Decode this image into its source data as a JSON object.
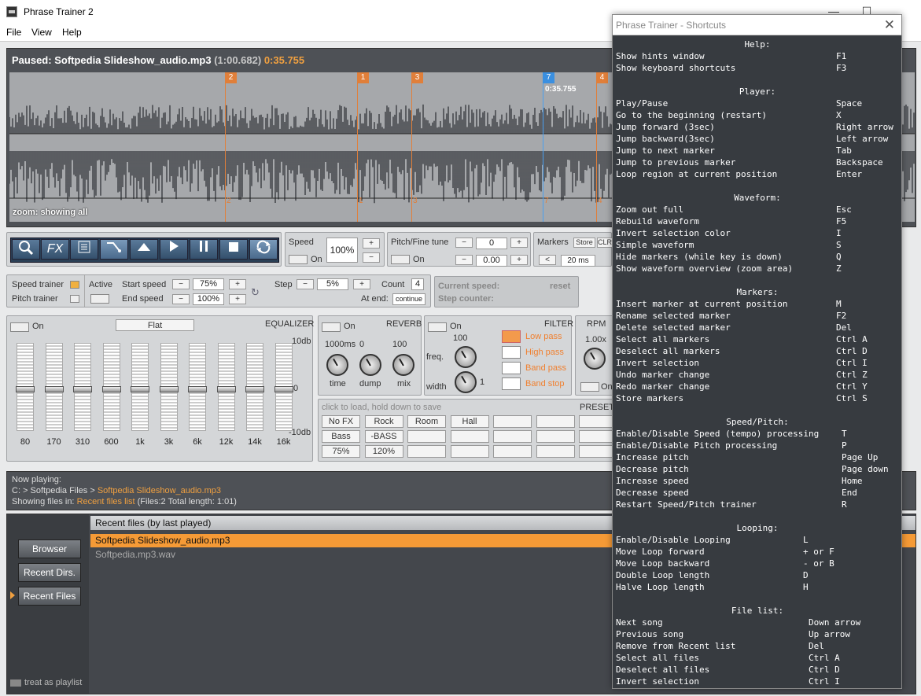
{
  "window": {
    "title": "Phrase Trainer 2"
  },
  "menu": [
    "File",
    "View",
    "Help"
  ],
  "waveform": {
    "state": "Paused:",
    "filename": "Softpedia Slideshow_audio.mp3",
    "length": "(1:00.682)",
    "position": "0:35.755",
    "zoom_label": "zoom: showing all",
    "cursor_time": "0:35.755",
    "markers": [
      {
        "label": "2",
        "pos": 0.238,
        "color": "orange"
      },
      {
        "label": "1",
        "pos": 0.384,
        "color": "orange"
      },
      {
        "label": "3",
        "pos": 0.444,
        "color": "orange"
      },
      {
        "label": "7",
        "pos": 0.589,
        "color": "blue"
      },
      {
        "label": "4",
        "pos": 0.648,
        "color": "orange"
      }
    ]
  },
  "toolbar": {
    "fx_label": "FX",
    "speed_label": "Speed",
    "speed_value": "100%",
    "speed_on": "On",
    "pitch_label": "Pitch/Fine tune",
    "pitch_value": "0",
    "fine_value": "0.00",
    "pitch_on": "On",
    "markers_label": "Markers",
    "markers_store": "Store",
    "markers_clr": "CLR",
    "markers_ms": "20 ms"
  },
  "trainer": {
    "speed_trainer": "Speed trainer",
    "pitch_trainer": "Pitch   trainer",
    "active": "Active",
    "start_speed_label": "Start speed",
    "start_speed": "75%",
    "end_speed_label": "End  speed",
    "end_speed": "100%",
    "step_label": "Step",
    "step_value": "5%",
    "count_label": "Count",
    "count_value": "4",
    "at_end_label": "At end:",
    "at_end_value": "continue",
    "current_speed": "Current speed:",
    "reset": "reset",
    "step_counter": "Step counter:"
  },
  "eq": {
    "on": "On",
    "preset": "Flat",
    "title": "EQUALIZER",
    "db_top": "10db",
    "db_mid": "0",
    "db_bot": "-10db",
    "bands": [
      "80",
      "170",
      "310",
      "600",
      "1k",
      "3k",
      "6k",
      "12k",
      "14k",
      "16k"
    ]
  },
  "reverb": {
    "on": "On",
    "title": "REVERB",
    "time_val": "1000ms",
    "dump_val": "0",
    "mix_val": "100",
    "time": "time",
    "dump": "dump",
    "mix": "mix"
  },
  "filter": {
    "on": "On",
    "title": "FILTER",
    "freq_val": "100",
    "freq": "freq.",
    "width": "width",
    "width_val": "1",
    "types": [
      "Low pass",
      "High pass",
      "Band pass",
      "Band stop"
    ]
  },
  "rpm": {
    "title": "RPM",
    "value": "1.00x",
    "on": "On"
  },
  "presets": {
    "hint": "click to load, hold down to save",
    "title": "PRESETS",
    "row1": [
      "No FX",
      "Rock",
      "Room",
      "Hall",
      "",
      "",
      ""
    ],
    "row2": [
      "Bass",
      "-BASS",
      "",
      "",
      "",
      "",
      ""
    ],
    "row3": [
      "75%",
      "120%",
      "",
      "",
      "",
      "",
      ""
    ]
  },
  "file_info": {
    "now_playing": "Now playing:",
    "path_prefix": "C: > Softpedia Files >",
    "path_file": "Softpedia Slideshow_audio.mp3",
    "showing": "Showing files in:",
    "list_name": "Recent files list",
    "stats": "(Files:2  Total length: 1:01)"
  },
  "nav": {
    "browser": "Browser",
    "recent_dirs": "Recent Dirs.",
    "recent_files": "Recent Files",
    "playlist": "treat as playlist"
  },
  "file_list": {
    "header": "Recent files (by last played)",
    "files": [
      "Softpedia Slideshow_audio.mp3",
      "Softpedia.mp3.wav"
    ]
  },
  "shortcuts": {
    "title": "Phrase Trainer - Shortcuts",
    "sections": [
      {
        "head": "Help:",
        "keycol": 280,
        "rows": [
          [
            "Show hints window",
            "F1"
          ],
          [
            "Show keyboard shortcuts",
            "F3"
          ]
        ]
      },
      {
        "head": "Player:",
        "keycol": 280,
        "rows": [
          [
            "Play/Pause",
            "Space"
          ],
          [
            "Go to the beginning (restart)",
            "X"
          ],
          [
            "Jump forward (3sec)",
            "Right arrow"
          ],
          [
            "Jump backward(3sec)",
            "Left arrow"
          ],
          [
            "Jump to next marker",
            "Tab"
          ],
          [
            "Jump to previous marker",
            "Backspace"
          ],
          [
            "Loop region at current position",
            "Enter"
          ]
        ]
      },
      {
        "head": "Waveform:",
        "keycol": 280,
        "rows": [
          [
            "Zoom out full",
            "Esc"
          ],
          [
            "Rebuild waveform",
            "F5"
          ],
          [
            "Invert selection color",
            "I"
          ],
          [
            "Simple waveform",
            "S"
          ],
          [
            "Hide markers (while key is down)",
            "Q"
          ],
          [
            "Show waveform overview (zoom area)",
            "Z"
          ]
        ]
      },
      {
        "head": "Markers:",
        "keycol": 280,
        "rows": [
          [
            "Insert marker at current position",
            "M"
          ],
          [
            "Rename selected marker",
            "F2"
          ],
          [
            "Delete selected marker",
            "Del"
          ],
          [
            "Select all markers",
            "Ctrl A"
          ],
          [
            "Deselect all markers",
            "Ctrl D"
          ],
          [
            "Invert selection",
            "Ctrl I"
          ],
          [
            "Undo marker change",
            "Ctrl Z"
          ],
          [
            "Redo marker change",
            "Ctrl Y"
          ],
          [
            "Store markers",
            "Ctrl S"
          ]
        ]
      },
      {
        "head": "Speed/Pitch:",
        "keycol": 287,
        "rows": [
          [
            "Enable/Disable Speed (tempo) processing",
            "T"
          ],
          [
            "Enable/Disable Pitch processing",
            "P"
          ],
          [
            "Increase pitch",
            "Page Up"
          ],
          [
            "Decrease pitch",
            "Page down"
          ],
          [
            "Increase speed",
            "Home"
          ],
          [
            "Decrease speed",
            "End"
          ],
          [
            "Restart Speed/Pitch trainer",
            "R"
          ]
        ]
      },
      {
        "head": "Looping:",
        "keycol": 238,
        "rows": [
          [
            "Enable/Disable Looping",
            "L"
          ],
          [
            "Move Loop forward",
            "+ or F"
          ],
          [
            "Move Loop backward",
            "- or B"
          ],
          [
            "Double Loop length",
            "D"
          ],
          [
            "Halve Loop length",
            "H"
          ]
        ]
      },
      {
        "head": "File list:",
        "keycol": 245,
        "rows": [
          [
            "Next song",
            "Down arrow"
          ],
          [
            "Previous song",
            "Up arrow"
          ],
          [
            "Remove from Recent list",
            "Del"
          ],
          [
            "Select all files",
            "Ctrl A"
          ],
          [
            "Deselect all files",
            "Ctrl D"
          ],
          [
            "Invert selection",
            "Ctrl I"
          ]
        ]
      }
    ]
  }
}
